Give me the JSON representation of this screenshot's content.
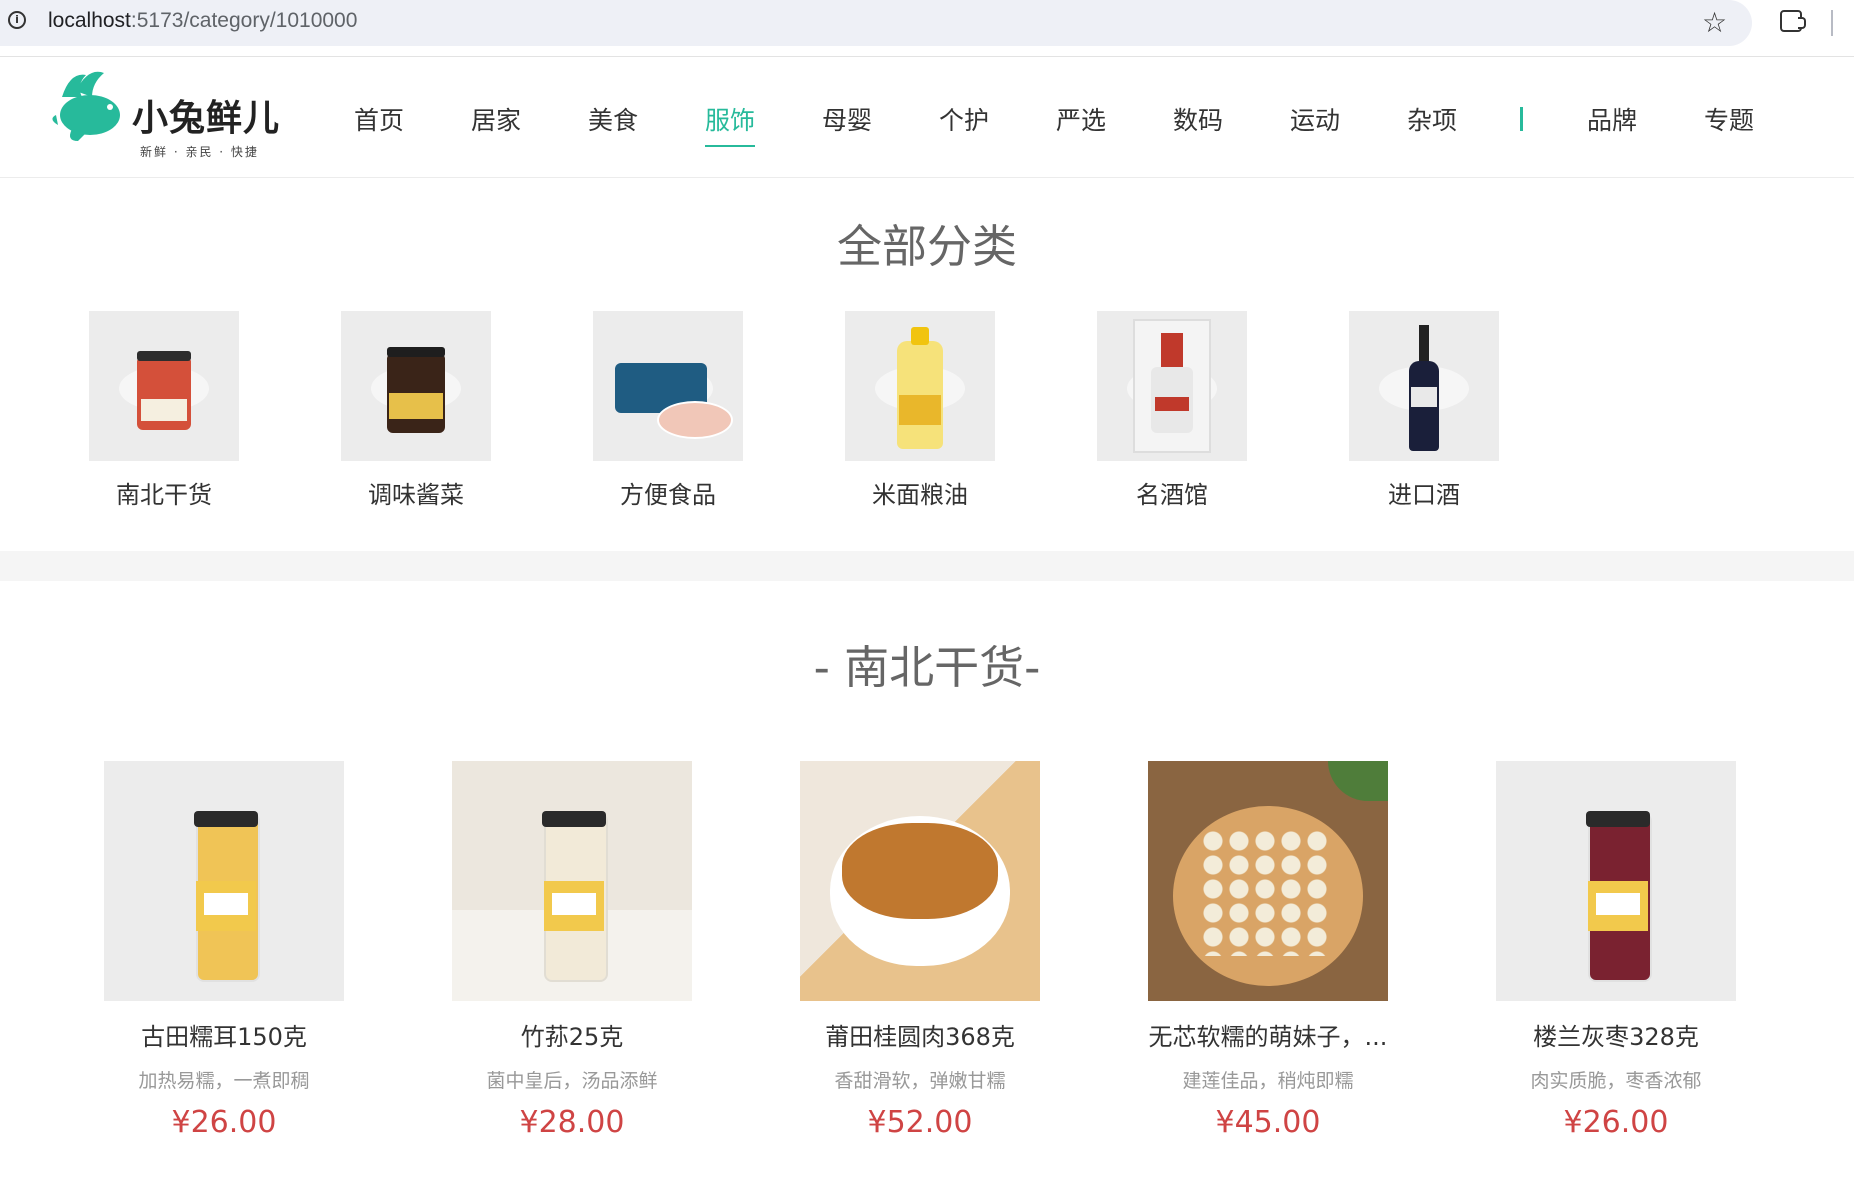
{
  "browser": {
    "url_host": "localhost",
    "url_path": ":5173/category/1010000"
  },
  "header": {
    "logo_name": "小兔鲜儿",
    "logo_slogan": "新鲜 · 亲民 · 快捷",
    "nav": [
      {
        "label": "首页"
      },
      {
        "label": "居家"
      },
      {
        "label": "美食"
      },
      {
        "label": "服饰",
        "active": true
      },
      {
        "label": "母婴"
      },
      {
        "label": "个护"
      },
      {
        "label": "严选"
      },
      {
        "label": "数码"
      },
      {
        "label": "运动"
      },
      {
        "label": "杂项"
      },
      {
        "label": "品牌"
      },
      {
        "label": "专题"
      }
    ],
    "accent_color": "#27ba9b"
  },
  "all_categories": {
    "title": "全部分类",
    "items": [
      {
        "name": "南北干货"
      },
      {
        "name": "调味酱菜"
      },
      {
        "name": "方便食品"
      },
      {
        "name": "米面粮油"
      },
      {
        "name": "名酒馆"
      },
      {
        "name": "进口酒"
      }
    ]
  },
  "sub_section": {
    "title": "- 南北干货-",
    "goods": [
      {
        "name": "古田糯耳150克",
        "desc": "加热易糯，一煮即稠",
        "price": "¥26.00"
      },
      {
        "name": "竹荪25克",
        "desc": "菌中皇后，汤品添鲜",
        "price": "¥28.00"
      },
      {
        "name": "莆田桂圆肉368克",
        "desc": "香甜滑软，弹嫩甘糯",
        "price": "¥52.00"
      },
      {
        "name": "无芯软糯的萌妹子，...",
        "desc": "建莲佳品，稍炖即糯",
        "price": "¥45.00"
      },
      {
        "name": "楼兰灰枣328克",
        "desc": "肉实质脆，枣香浓郁",
        "price": "¥26.00"
      }
    ],
    "price_color": "#cf4444"
  }
}
